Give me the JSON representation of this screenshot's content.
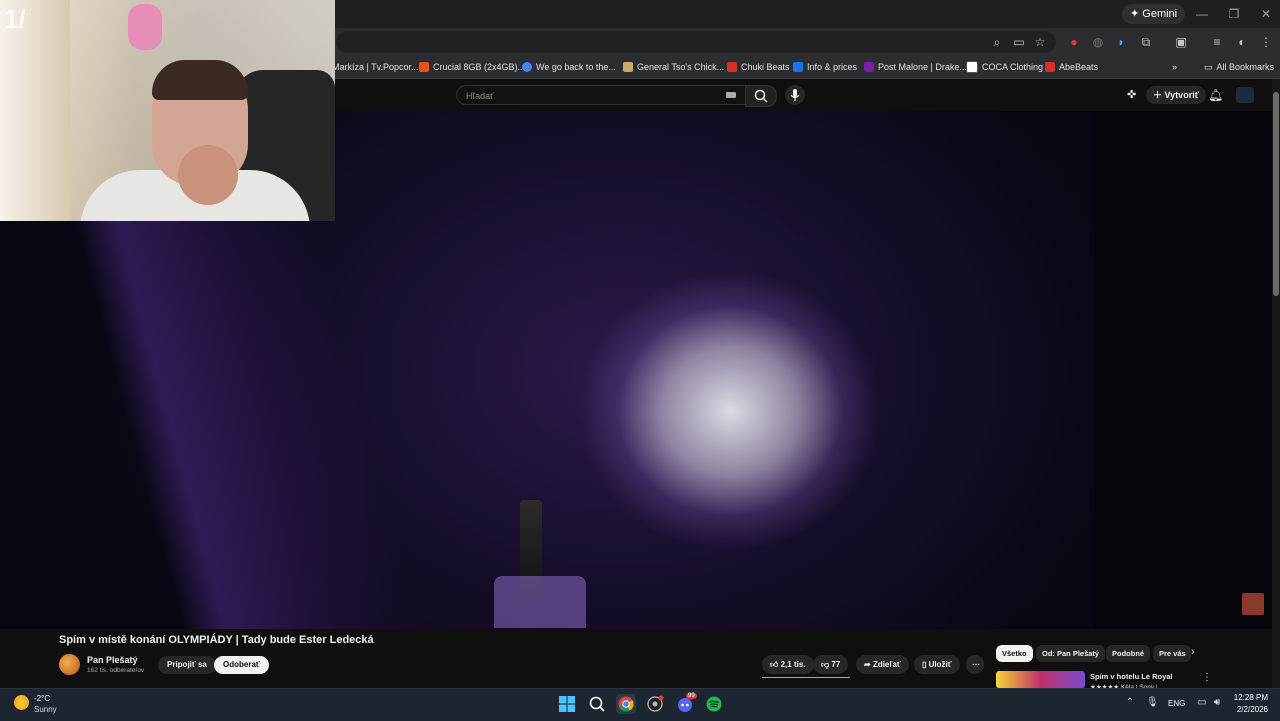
{
  "browser": {
    "gemini_label": "Gemini",
    "bookmarks": [
      {
        "label": "Markíza | Tv.Popcor...",
        "color": "#ffffff"
      },
      {
        "label": "Crucial 8GB (2x4GB)...",
        "color": "#e8501c"
      },
      {
        "label": "We go back to the...",
        "color": "#4285f4"
      },
      {
        "label": "General Tso's Chick...",
        "color": "#c9a86a"
      },
      {
        "label": "Chuki Beats",
        "color": "#d93025"
      },
      {
        "label": "Info & prices",
        "color": "#1a73e8"
      },
      {
        "label": "Post Malone | Drake...",
        "color": "#7b1fa2"
      },
      {
        "label": "COCA Clothing",
        "color": "#222222"
      },
      {
        "label": "AbeBeats",
        "color": "#d93025"
      }
    ],
    "all_bookmarks_label": "All Bookmarks"
  },
  "youtube": {
    "search_placeholder": "Hľadať",
    "create_label": "Vytvoriť",
    "video": {
      "title": "Spím v místě konání OLYMPIÁDY | Tady bude Ester Ledecká",
      "channel_name": "Pan Plešatý",
      "subscribers": "162 tis. odberateľov",
      "join_label": "Pripojiť sa",
      "unsubscribe_label": "Odoberať",
      "likes": "2,1 tis.",
      "dislikes": "77",
      "share_label": "Zdieľať",
      "save_label": "Uložiť"
    },
    "chips": [
      "Všetko",
      "Od: Pan Plešatý",
      "Podobné",
      "Pre vás"
    ],
    "recommendation": {
      "title": "Spím v hotelu Le Royal",
      "subtitle": "★★★★★ Kěla | Sony |"
    }
  },
  "webcam": {
    "overlay_text": "1/"
  },
  "taskbar": {
    "weather_temp": "-2°C",
    "weather_desc": "Sunny",
    "language": "ENG",
    "time": "12:28 PM",
    "date": "2/2/2026",
    "discord_badge": "99"
  }
}
